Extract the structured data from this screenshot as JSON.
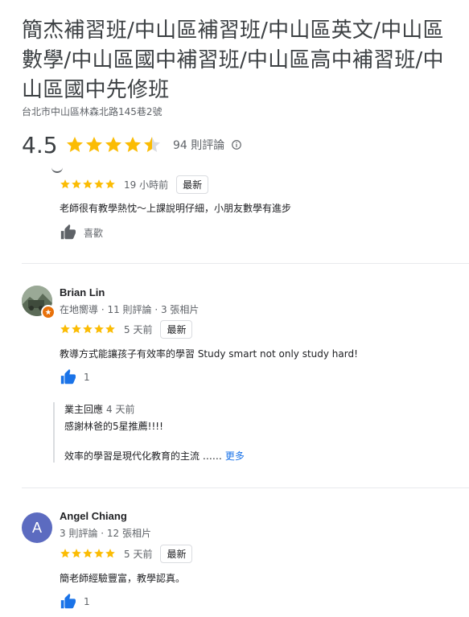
{
  "place": {
    "title": "簡杰補習班/中山區補習班/中山區英文/中山區數學/中山區國中補習班/中山區高中補習班/中山區國中先修班",
    "address": "台北市中山區林森北路145巷2號",
    "rating": "4.5",
    "rating_value": 4.5,
    "review_count": "94 則評論",
    "info_icon": "info-icon"
  },
  "colors": {
    "star": "#fbbc04",
    "star_empty": "#dadce0",
    "like_active": "#1a73e8",
    "like_inactive": "#5f6368"
  },
  "reviews": [
    {
      "stars": 5,
      "time": "19 小時前",
      "badge": "最新",
      "text": "老師很有教學熱忱～上課說明仔細，小朋友數學有進步",
      "like_label": "喜歡"
    },
    {
      "name": "Brian Lin",
      "meta": "在地嚮導 · 11 則評論 · 3 張相片",
      "stars": 5,
      "time": "5 天前",
      "badge": "最新",
      "text": "教導方式能讓孩子有效率的學習  Study smart  not only study hard!",
      "like_count": "1",
      "owner_reply": {
        "label": "業主回應",
        "time": "4 天前",
        "line1": "感謝林爸的5星推薦!!!!",
        "line2": "效率的學習是現代化教育的主流 ……",
        "more": "更多"
      }
    },
    {
      "name": "Angel Chiang",
      "avatar_letter": "A",
      "meta": "3 則評論 · 12 張相片",
      "stars": 5,
      "time": "5 天前",
      "badge": "最新",
      "text": "簡老師經驗豐富，教學認真。",
      "like_count": "1"
    }
  ]
}
